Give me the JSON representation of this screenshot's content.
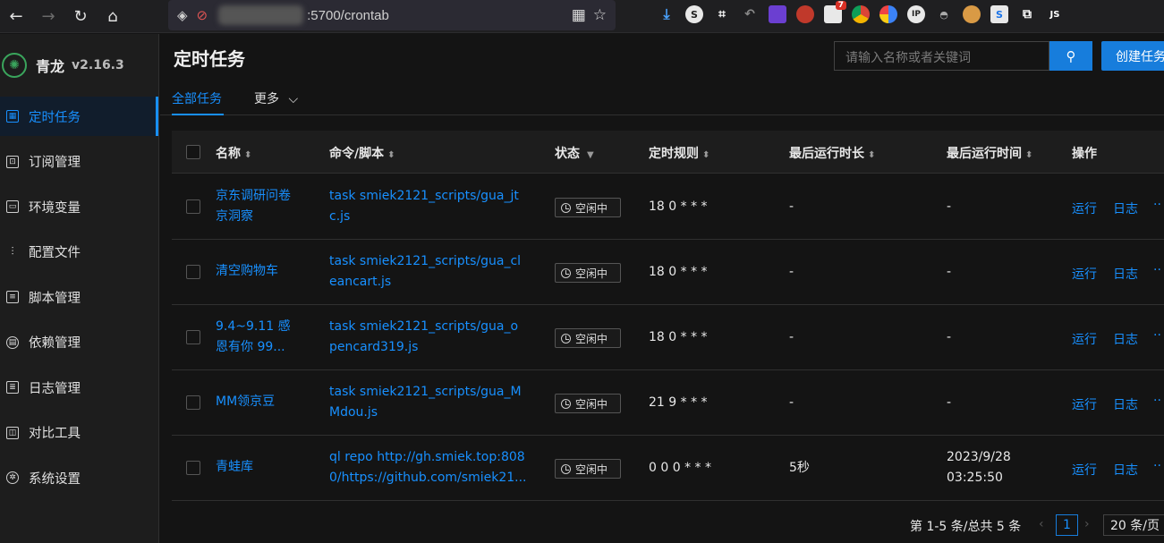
{
  "browser": {
    "url": ":5700/crontab",
    "badge_count": "7",
    "ext_labels": [
      "S",
      "JS"
    ]
  },
  "sidebar": {
    "app_name": "青龙",
    "version": "v2.16.3",
    "items": [
      {
        "label": "定时任务",
        "icon": "calendar-icon",
        "active": true
      },
      {
        "label": "订阅管理",
        "icon": "subscription-icon"
      },
      {
        "label": "环境变量",
        "icon": "monitor-icon"
      },
      {
        "label": "配置文件",
        "icon": "sliders-icon"
      },
      {
        "label": "脚本管理",
        "icon": "script-icon"
      },
      {
        "label": "依赖管理",
        "icon": "package-icon"
      },
      {
        "label": "日志管理",
        "icon": "log-icon"
      },
      {
        "label": "对比工具",
        "icon": "diff-icon"
      },
      {
        "label": "系统设置",
        "icon": "settings-icon"
      }
    ]
  },
  "header": {
    "title": "定时任务",
    "search_placeholder": "请输入名称或者关键词",
    "create_label": "创建任务"
  },
  "tabs": {
    "all": "全部任务",
    "more": "更多"
  },
  "table": {
    "columns": {
      "name": "名称",
      "command": "命令/脚本",
      "status": "状态",
      "schedule": "定时规则",
      "last_duration": "最后运行时长",
      "last_time": "最后运行时间",
      "actions": "操作"
    },
    "rows": [
      {
        "name1": "京东调研问卷",
        "name2": "京洞察",
        "cmd1": "task smiek2121_scripts/gua_jt",
        "cmd2": "c.js",
        "status": "空闲中",
        "schedule": "18 0 * * *",
        "duration": "-",
        "time1": "-",
        "time2": "",
        "run": "运行",
        "log": "日志"
      },
      {
        "name1": "清空购物车",
        "name2": "",
        "cmd1": "task smiek2121_scripts/gua_cl",
        "cmd2": "eancart.js",
        "status": "空闲中",
        "schedule": "18 0 * * *",
        "duration": "-",
        "time1": "-",
        "time2": "",
        "run": "运行",
        "log": "日志"
      },
      {
        "name1": "9.4~9.11 感",
        "name2": "恩有你 99...",
        "cmd1": "task smiek2121_scripts/gua_o",
        "cmd2": "pencard319.js",
        "status": "空闲中",
        "schedule": "18 0 * * *",
        "duration": "-",
        "time1": "-",
        "time2": "",
        "run": "运行",
        "log": "日志"
      },
      {
        "name1": "MM领京豆",
        "name2": "",
        "cmd1": "task smiek2121_scripts/gua_M",
        "cmd2": "Mdou.js",
        "status": "空闲中",
        "schedule": "21 9 * * *",
        "duration": "-",
        "time1": "-",
        "time2": "",
        "run": "运行",
        "log": "日志"
      },
      {
        "name1": "青蛙库",
        "name2": "",
        "cmd1": "ql repo http://gh.smiek.top:808",
        "cmd2": "0/https://github.com/smiek21...",
        "status": "空闲中",
        "schedule": "0 0 0 * * *",
        "duration": "5秒",
        "time1": "2023/9/28",
        "time2": "03:25:50",
        "run": "运行",
        "log": "日志"
      }
    ]
  },
  "pagination": {
    "total_text": "第 1-5 条/总共 5 条",
    "current_page": "1",
    "page_size": "20 条/页"
  }
}
